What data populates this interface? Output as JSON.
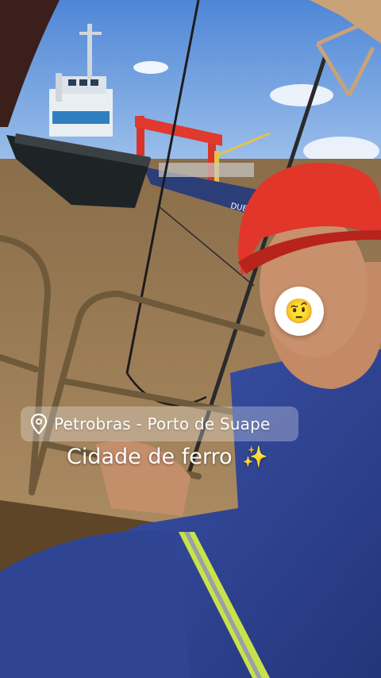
{
  "story": {
    "location_sticker": {
      "icon": "location-pin-icon",
      "text": "Petrobras - Porto de Suape"
    },
    "caption": {
      "text": "Cidade de ferro",
      "emoji": "✨"
    },
    "face_sticker": {
      "emoji": "🤨"
    }
  },
  "scene": {
    "ship_name_fragment": "DUBLIN",
    "colors": {
      "sky": "#6fa6e6",
      "water": "#a7865c",
      "hard_hat": "#e2362a",
      "coverall": "#2c3f8f",
      "reflective_stripe": "#c8e24a"
    }
  }
}
